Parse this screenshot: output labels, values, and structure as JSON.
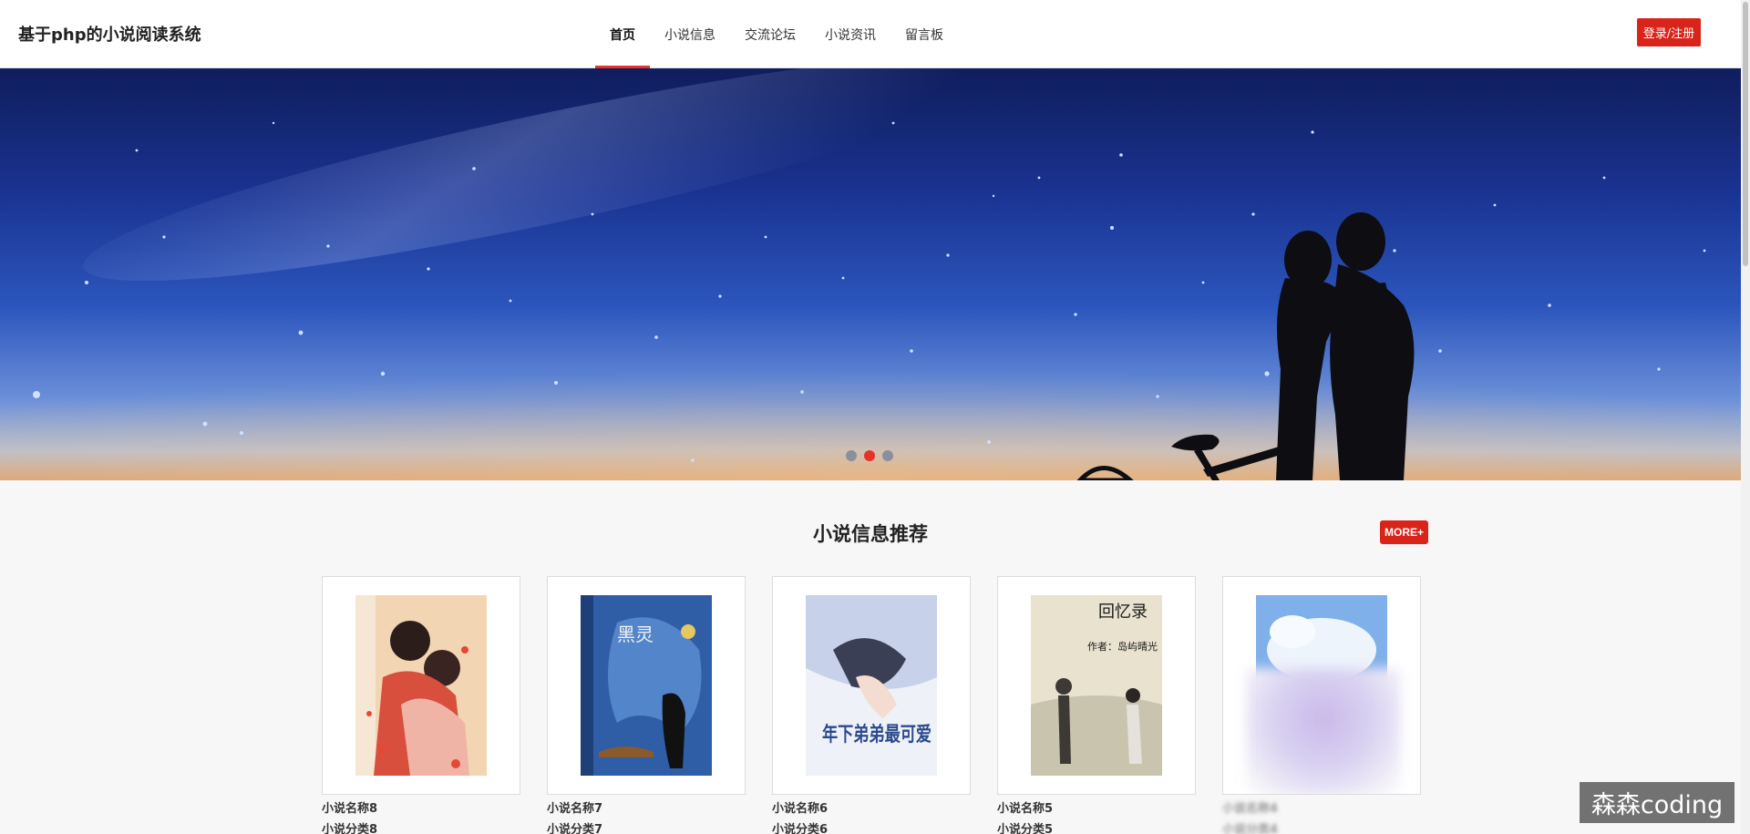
{
  "header": {
    "brand": "基于php的小说阅读系统",
    "nav": [
      "首页",
      "小说信息",
      "交流论坛",
      "小说资讯",
      "留言板"
    ],
    "active_index": 0,
    "login_label": "登录/注册"
  },
  "banner": {
    "active_dot": 1,
    "dot_count": 3
  },
  "section": {
    "title": "小说信息推荐",
    "more_label": "MORE+"
  },
  "cards": [
    {
      "name": "小说名称8",
      "category": "小说分类8"
    },
    {
      "name": "小说名称7",
      "category": "小说分类7"
    },
    {
      "name": "小说名称6",
      "category": "小说分类6"
    },
    {
      "name": "小说名称5",
      "category": "小说分类5"
    },
    {
      "name": "小说名称4",
      "category": "小说分类4"
    }
  ],
  "cover_texts": {
    "c2": "黑灵",
    "c3": "年下弟弟最可爱",
    "c4a": "回忆录",
    "c4b": "作者：岛屿晴光"
  },
  "watermark": "森森coding",
  "colors": {
    "accent": "#d9241a",
    "banner_sky": "#1a3391"
  }
}
